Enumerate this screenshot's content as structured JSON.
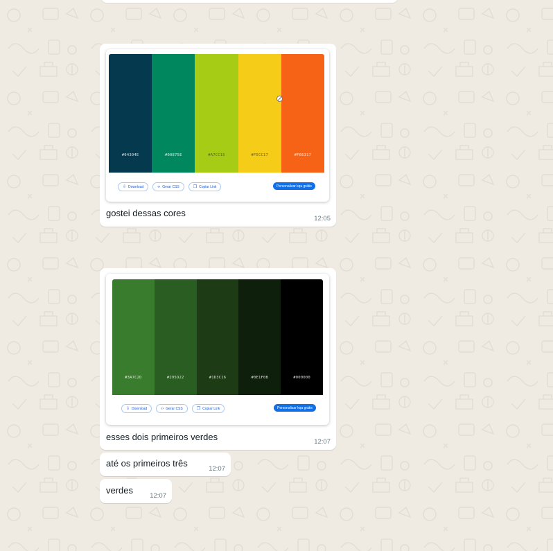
{
  "messages": [
    {
      "palette": [
        "#04394E",
        "#00875E",
        "#A7CC15",
        "#F5CC17",
        "#F66317"
      ],
      "hex_labels": [
        "#04394E",
        "#00875E",
        "#A7CC15",
        "#F5CC17",
        "#F66317"
      ],
      "actions": [
        "Download",
        "Gerar CSS",
        "Copiar Link"
      ],
      "cta": "Personalizar kqu grátis",
      "caption": "gostei dessas cores",
      "time": "12:05"
    },
    {
      "palette": [
        "#3A7C2D",
        "#295D22",
        "#1D3C16",
        "#0E1F0B",
        "#000000"
      ],
      "hex_labels": [
        "#3A7C2D",
        "#295D22",
        "#1D3C16",
        "#0E1F0B",
        "#000000"
      ],
      "actions": [
        "Download",
        "Gerar CSS",
        "Copiar Link"
      ],
      "cta": "Personalizar kqa grátis",
      "caption": "esses dois primeiros verdes",
      "time": "12:07"
    },
    {
      "text": "até os primeiros três",
      "time": "12:07"
    },
    {
      "text": "verdes",
      "time": "12:07"
    }
  ],
  "icons": {
    "download": "download-icon",
    "css": "code-icon",
    "copy": "copy-icon",
    "blocked": "blocked-cursor-icon"
  }
}
